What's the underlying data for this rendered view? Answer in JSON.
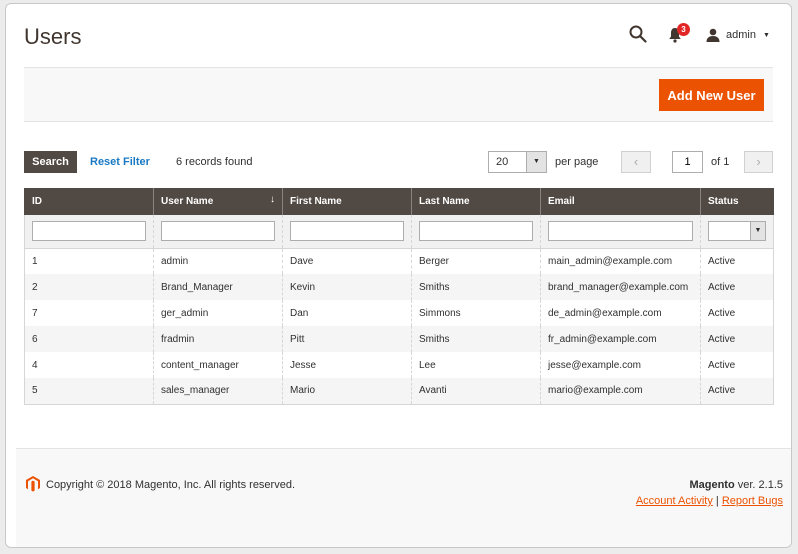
{
  "header": {
    "title": "Users",
    "notifications_count": "3",
    "user_name": "admin"
  },
  "actions": {
    "add_button_label": "Add New User"
  },
  "toolbar": {
    "search_label": "Search",
    "reset_label": "Reset Filter",
    "records_found": "6 records found",
    "per_page_value": "20",
    "per_page_label": "per page",
    "current_page": "1",
    "of_pages": "of 1"
  },
  "grid": {
    "columns": [
      "ID",
      "User Name",
      "First Name",
      "Last Name",
      "Email",
      "Status"
    ],
    "rows": [
      [
        "1",
        "admin",
        "Dave",
        "Berger",
        "main_admin@example.com",
        "Active"
      ],
      [
        "2",
        "Brand_Manager",
        "Kevin",
        "Smiths",
        "brand_manager@example.com",
        "Active"
      ],
      [
        "7",
        "ger_admin",
        "Dan",
        "Simmons",
        "de_admin@example.com",
        "Active"
      ],
      [
        "6",
        "fradmin",
        "Pitt",
        "Smiths",
        "fr_admin@example.com",
        "Active"
      ],
      [
        "4",
        "content_manager",
        "Jesse",
        "Lee",
        "jesse@example.com",
        "Active"
      ],
      [
        "5",
        "sales_manager",
        "Mario",
        "Avanti",
        "mario@example.com",
        "Active"
      ]
    ]
  },
  "footer": {
    "copyright": "Copyright © 2018 Magento, Inc. All rights reserved.",
    "brand": "Magento",
    "version": " ver. 2.1.5",
    "account_activity": "Account Activity",
    "separator": "|",
    "report_bugs": "Report Bugs"
  },
  "colors": {
    "accent": "#eb5202",
    "header_dark": "#514943",
    "link_blue": "#1979c3",
    "badge_red": "#e22626"
  }
}
